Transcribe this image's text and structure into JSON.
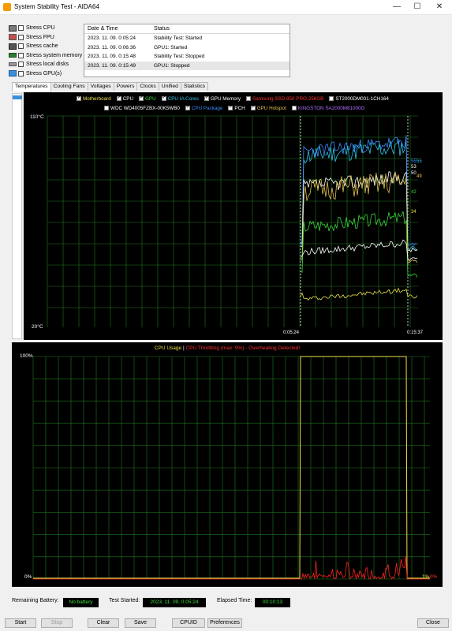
{
  "window": {
    "title": "System Stability Test - AIDA64",
    "minimize": "—",
    "maximize": "☐",
    "close": "✕"
  },
  "stress": [
    {
      "label": "Stress CPU",
      "icon": "cpu-icon"
    },
    {
      "label": "Stress FPU",
      "icon": "fpu-icon"
    },
    {
      "label": "Stress cache",
      "icon": "cache-icon"
    },
    {
      "label": "Stress system memory",
      "icon": "memory-icon"
    },
    {
      "label": "Stress local disks",
      "icon": "disk-icon"
    },
    {
      "label": "Stress GPU(s)",
      "icon": "gpu-icon"
    }
  ],
  "log": {
    "headers": [
      "Date & Time",
      "Status"
    ],
    "rows": [
      [
        "2023. 11. 09. 0:05:24",
        "Stability Test: Started"
      ],
      [
        "2023. 11. 09. 0:06:36",
        "GPU1: Started"
      ],
      [
        "2023. 11. 09. 0:15:48",
        "Stability Test: Stopped"
      ],
      [
        "2023. 11. 09. 0:15:49",
        "GPU1: Stopped"
      ]
    ]
  },
  "tabs": [
    "Temperatures",
    "Cooling Fans",
    "Voltages",
    "Powers",
    "Clocks",
    "Unified",
    "Statistics"
  ],
  "temp_legend_row1": [
    {
      "label": "Motherboard",
      "color": "#e8e04a",
      "checked": true
    },
    {
      "label": "CPU",
      "color": "#ffffff",
      "checked": true
    },
    {
      "label": "GPU",
      "color": "#3cd83c",
      "checked": true
    },
    {
      "label": "CPU IA Cores",
      "color": "#2ec4e8",
      "checked": true
    },
    {
      "label": "GPU Memory",
      "color": "#ffffff",
      "checked": true
    },
    {
      "label": "Samsung SSD 850 PRO 256GB",
      "color": "#ff3030",
      "checked": false
    },
    {
      "label": "ST2000DM001-1CH164",
      "color": "#ffffff",
      "checked": false
    }
  ],
  "temp_legend_row2": [
    {
      "label": "WDC WD4005FZBX-00K5WB0",
      "color": "#ffffff",
      "checked": false
    },
    {
      "label": "CPU Package",
      "color": "#3a8cff",
      "checked": true
    },
    {
      "label": "PCH",
      "color": "#ffffff",
      "checked": true
    },
    {
      "label": "GPU Hotspot",
      "color": "#e0c050",
      "checked": true
    },
    {
      "label": "KINGSTON SA2000M81000G",
      "color": "#b070ff",
      "checked": false
    }
  ],
  "temp_chart": {
    "ymax_label": "110°C",
    "ymin_label": "20°C",
    "ylim": [
      20,
      110
    ],
    "x_labels": [
      "0:05:24",
      "0:15:37"
    ],
    "end_values": [
      {
        "text": "55",
        "color": "#3a8cff"
      },
      {
        "text": "55",
        "color": "#2ec4e8"
      },
      {
        "text": "53",
        "color": "#ffffff"
      },
      {
        "text": "50",
        "color": "#ffffff"
      },
      {
        "text": "49",
        "color": "#e0c050"
      },
      {
        "text": "42",
        "color": "#3cd83c"
      },
      {
        "text": "34",
        "color": "#e8e04a"
      }
    ]
  },
  "usage_chart": {
    "title_cpu": "CPU Usage",
    "title_sep": "|",
    "title_throttle": "CPU Throttling (max: 9%) - Overheating Detected!",
    "y_top": "100%",
    "y_bottom": "0%",
    "end_value_cpu": "1%",
    "end_value_throttle": "0%"
  },
  "status": {
    "battery_label": "Remaining Battery:",
    "battery_value": "No battery",
    "started_label": "Test Started:",
    "started_value": "2023. 11. 09. 0:05:24",
    "elapsed_label": "Elapsed Time:",
    "elapsed_value": "00:10:13"
  },
  "buttons": {
    "start": "Start",
    "stop": "Stop",
    "clear": "Clear",
    "save": "Save",
    "cpuid": "CPUID",
    "preferences": "Preferences",
    "close": "Close"
  }
}
